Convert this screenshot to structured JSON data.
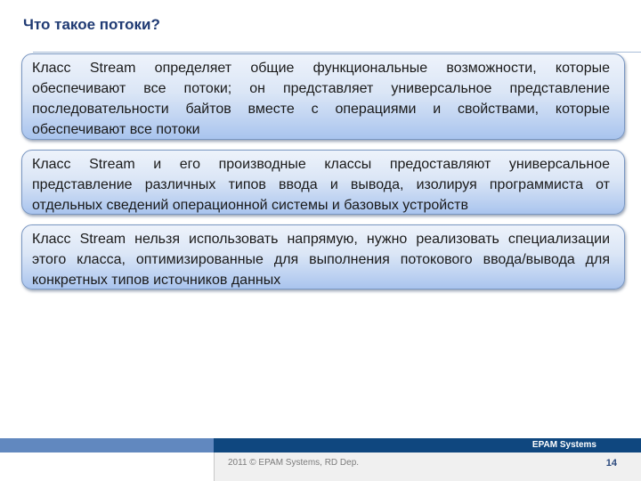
{
  "slide": {
    "title": "Что такое потоки?",
    "blocks": [
      {
        "text": "Класс Stream определяет общие функциональные возможности, которые обеспечивают все потоки; он представляет универсальное представление последовательности байтов вместе с операциями и свойствами, которые обеспечивают все потоки"
      },
      {
        "text": "Класс Stream и его производные классы предоставляют универсальное представление различных типов ввода и вывода, изолируя программиста от отдельных сведений операционной системы и базовых устройств"
      },
      {
        "text": "Класс Stream нельзя использовать напрямую, нужно реализовать специализации этого класса, оптимизированные для выполнения потокового ввода/вывода для конкретных типов источников данных"
      }
    ]
  },
  "footer": {
    "brand": "EPAM Systems",
    "copyright": "2011 © EPAM Systems, RD Dep.",
    "page_number": "14"
  },
  "colors": {
    "title": "#1f3a73",
    "footer_dark": "#0f477f",
    "footer_light": "#6188bf",
    "box_border": "#7a97c2"
  }
}
